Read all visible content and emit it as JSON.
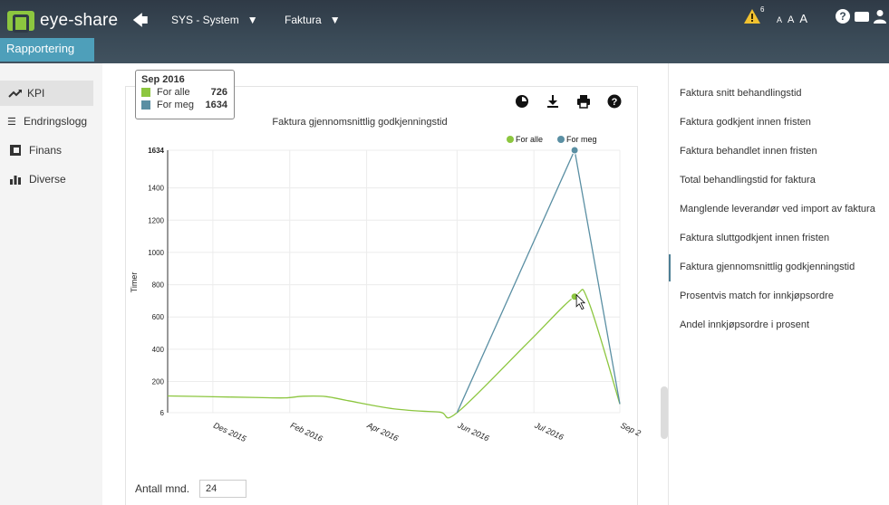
{
  "header": {
    "logo_text": "eye-share",
    "nav_system": "SYS - System",
    "nav_faktura": "Faktura",
    "warning_count": "6",
    "font_sizes": [
      "A",
      "A",
      "A"
    ],
    "active_tab": "Rapportering"
  },
  "sidebar": {
    "items": [
      {
        "label": "KPI",
        "icon": "trend-icon"
      },
      {
        "label": "Endringslogg",
        "icon": "list-icon"
      },
      {
        "label": "Finans",
        "icon": "finance-icon"
      },
      {
        "label": "Diverse",
        "icon": "bar-chart-icon"
      }
    ]
  },
  "chart_tools": [
    "pie-icon",
    "download-icon",
    "print-icon",
    "help-icon"
  ],
  "tooltip": {
    "date": "Sep 2016",
    "rows": [
      {
        "name": "For alle",
        "value": "726"
      },
      {
        "name": "For meg",
        "value": "1634"
      }
    ]
  },
  "chart_data": {
    "type": "line",
    "title": "Faktura gjennomsnittlig godkjenningstid",
    "ylabel": "Timer",
    "xlabel": "",
    "ylim": [
      6,
      1634
    ],
    "y_ticks": [
      "1634",
      "1400",
      "1200",
      "1000",
      "800",
      "600",
      "400",
      "200",
      "6"
    ],
    "x_ticks": [
      "Des 2015",
      "Feb 2016",
      "Apr 2016",
      "Jun 2016",
      "Jul 2016",
      "Sep 2"
    ],
    "legend_position": "top-right",
    "series": [
      {
        "name": "For alle",
        "color": "#8cc63f",
        "points": [
          [
            0,
            110
          ],
          [
            1,
            105
          ],
          [
            2,
            100
          ],
          [
            2.6,
            98
          ],
          [
            3,
            108
          ],
          [
            3.5,
            106
          ],
          [
            4,
            80
          ],
          [
            5,
            30
          ],
          [
            6,
            10
          ],
          [
            6.4,
            6
          ],
          [
            8,
            450
          ],
          [
            9,
            726
          ],
          [
            9.3,
            700
          ],
          [
            10,
            60
          ]
        ]
      },
      {
        "name": "For meg",
        "color": "#5a8fa3",
        "points": [
          [
            6.4,
            6
          ],
          [
            9,
            1634
          ],
          [
            10,
            60
          ]
        ]
      }
    ]
  },
  "antall": {
    "label": "Antall mnd.",
    "value": "24"
  },
  "reports": [
    "Faktura snitt behandlingstid",
    "Faktura godkjent innen fristen",
    "Faktura behandlet innen fristen",
    "Total behandlingstid for faktura",
    "Manglende leverandør ved import av faktura",
    "Faktura sluttgodkjent innen fristen",
    "Faktura gjennomsnittlig godkjenningstid",
    "Prosentvis match for innkjøpsordre",
    "Andel innkjøpsordre i prosent"
  ],
  "colors": {
    "accent": "#4e9fba",
    "header": "#3a4a57",
    "series_all": "#8cc63f",
    "series_me": "#5a8fa3"
  }
}
